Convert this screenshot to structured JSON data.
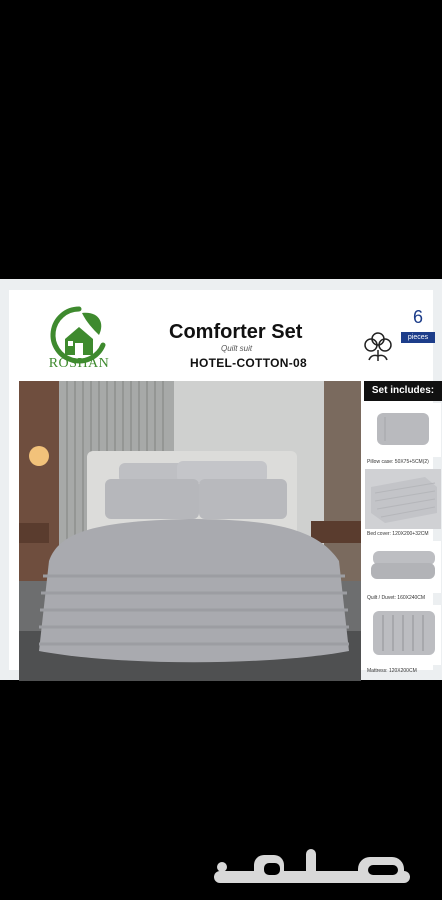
{
  "brand": {
    "name": "ROSHAN"
  },
  "product": {
    "title": "Comforter Set",
    "subtitle": "Quilt suit",
    "code": "HOTEL-COTTON-08",
    "pieces_count": "6",
    "pieces_label": "pieces"
  },
  "set_includes": {
    "heading": "Set includes:",
    "items": [
      {
        "icon": "pillowcase",
        "caption": "Pillow case: 50X75+5CM(2)"
      },
      {
        "icon": "bed-cover",
        "caption": "Bed cover: 120X200+32CM"
      },
      {
        "icon": "quilt",
        "caption": "Quilt / Duvet: 160X240CM"
      },
      {
        "icon": "mattress",
        "caption": "Mattress: 120X200CM"
      }
    ]
  },
  "watermark": {
    "text": "حراج"
  },
  "colors": {
    "logo_green": "#3e8a2e",
    "accent_blue": "#1d3d8a",
    "background": "#000000"
  }
}
